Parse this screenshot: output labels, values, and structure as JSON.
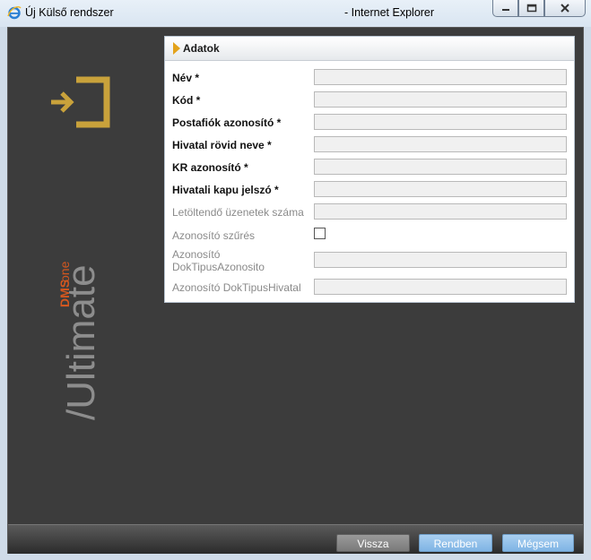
{
  "window": {
    "title": "Új Külső rendszer",
    "browser": "- Internet Explorer"
  },
  "brand": {
    "product_dms": "DMS",
    "product_one": "one",
    "product_edition": "/Ultimate",
    "accent_color": "#c9a23b"
  },
  "panel": {
    "title": "Adatok",
    "fields": [
      {
        "label": "Név *",
        "value": ""
      },
      {
        "label": "Kód *",
        "value": ""
      },
      {
        "label": "Postafiók azonosító *",
        "value": ""
      },
      {
        "label": "Hivatal rövid neve *",
        "value": ""
      },
      {
        "label": "KR azonosító *",
        "value": ""
      },
      {
        "label": "Hivatali kapu jelszó *",
        "value": ""
      },
      {
        "label": "Letöltendő üzenetek száma",
        "value": ""
      },
      {
        "label": "Azonosító szűrés",
        "checked": false
      },
      {
        "label": "Azonosító DokTipusAzonosito",
        "value": ""
      },
      {
        "label": "Azonosító DokTipusHivatal",
        "value": ""
      }
    ]
  },
  "buttons": {
    "back": "Vissza",
    "ok": "Rendben",
    "cancel": "Mégsem"
  }
}
